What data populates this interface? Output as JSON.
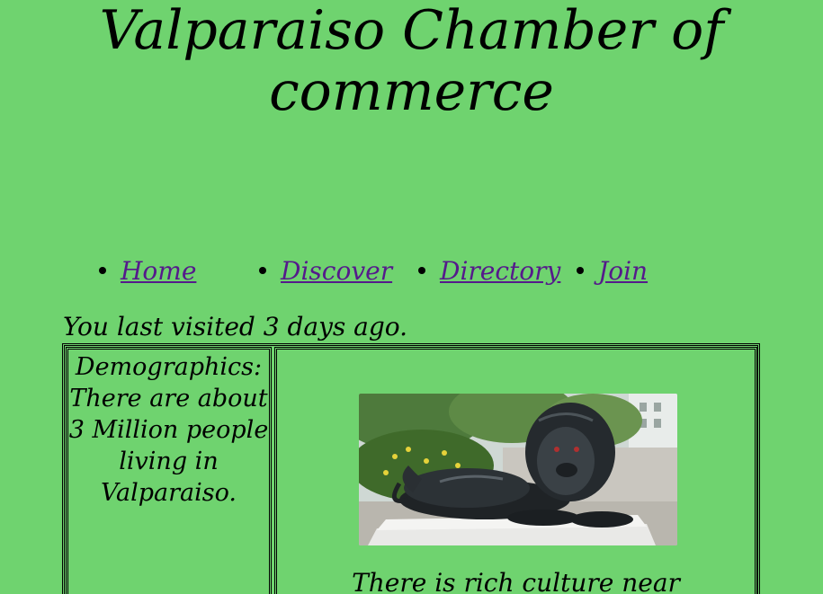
{
  "header": {
    "title_line1": "Valparaiso Chamber of",
    "title_line2": "commerce"
  },
  "nav": {
    "items": [
      {
        "label": "Home"
      },
      {
        "label": "Discover"
      },
      {
        "label": "Directory"
      },
      {
        "label": "Join"
      }
    ]
  },
  "visit": {
    "message": "You last visited 3 days ago."
  },
  "demographics": {
    "text": "Demographics: There are about 3 Million people living in Valparaiso."
  },
  "feature": {
    "image_subject": "lion-statue",
    "caption": "There is rich culture near"
  },
  "colors": {
    "background": "#6fd36f",
    "link": "#551a8b"
  }
}
